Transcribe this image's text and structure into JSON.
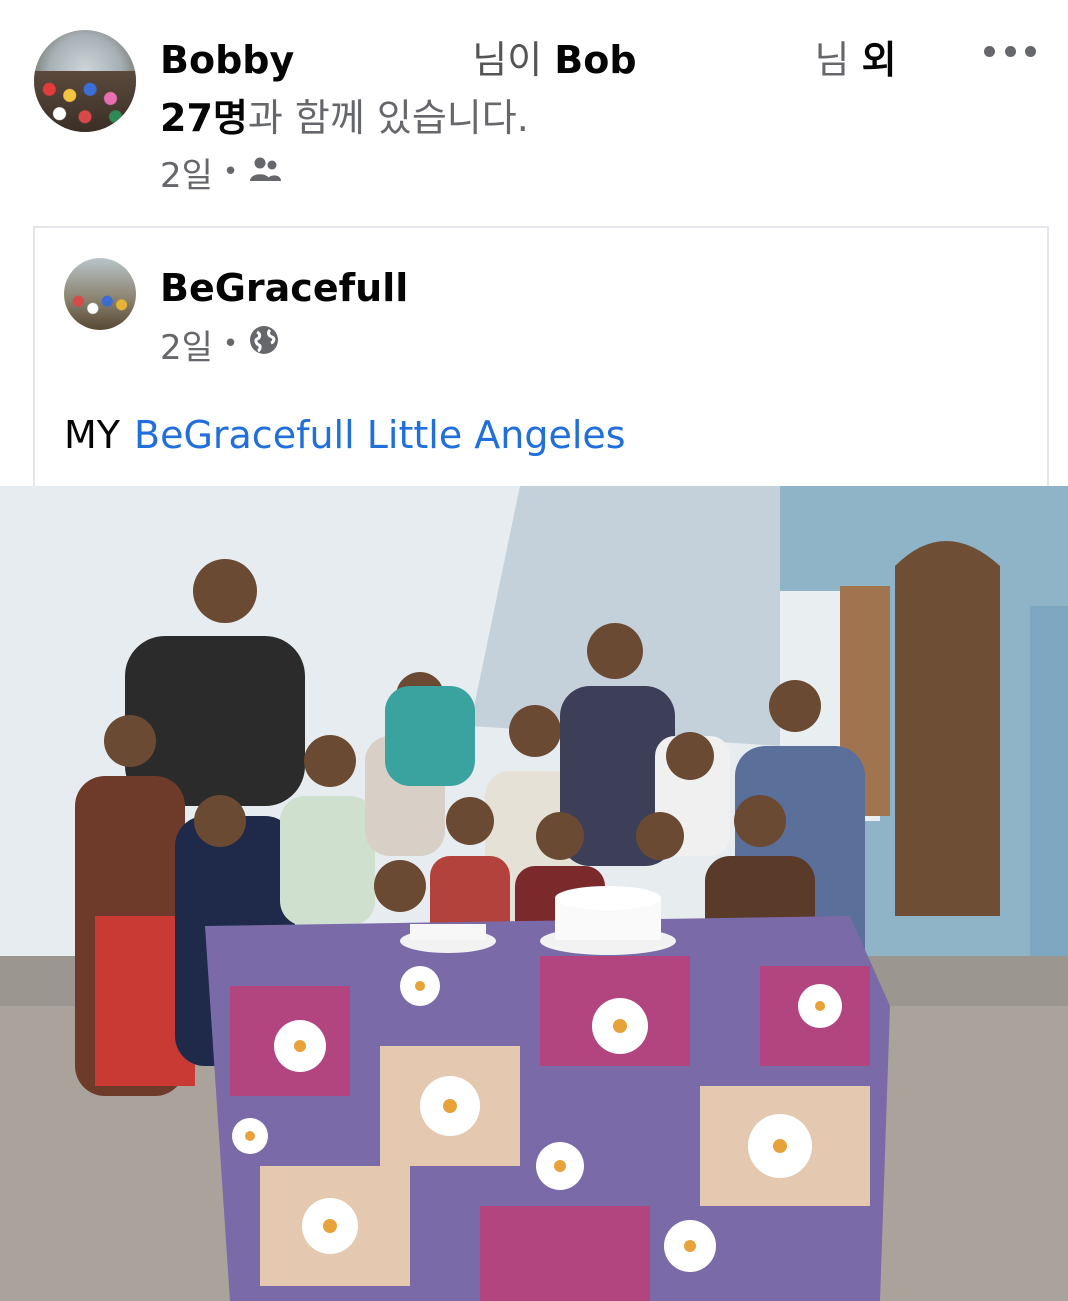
{
  "post": {
    "author": "Bobby",
    "tag_suffix_1": "님이",
    "tagged_name": "Bob",
    "tag_suffix_2": "님",
    "and_others": "외",
    "others_count": "27명",
    "with_text": "과 함께 있습니다.",
    "time": "2일",
    "separator": "•",
    "audience_icon": "friends-icon"
  },
  "shared": {
    "page_name": "BeGracefull",
    "time": "2일",
    "separator": "•",
    "audience_icon": "globe-icon",
    "text_prefix": "MY",
    "link_text": "BeGracefull Little Angeles"
  },
  "colors": {
    "link": "#216fdb",
    "secondary_text": "#65676b",
    "border": "#e4e6eb"
  }
}
